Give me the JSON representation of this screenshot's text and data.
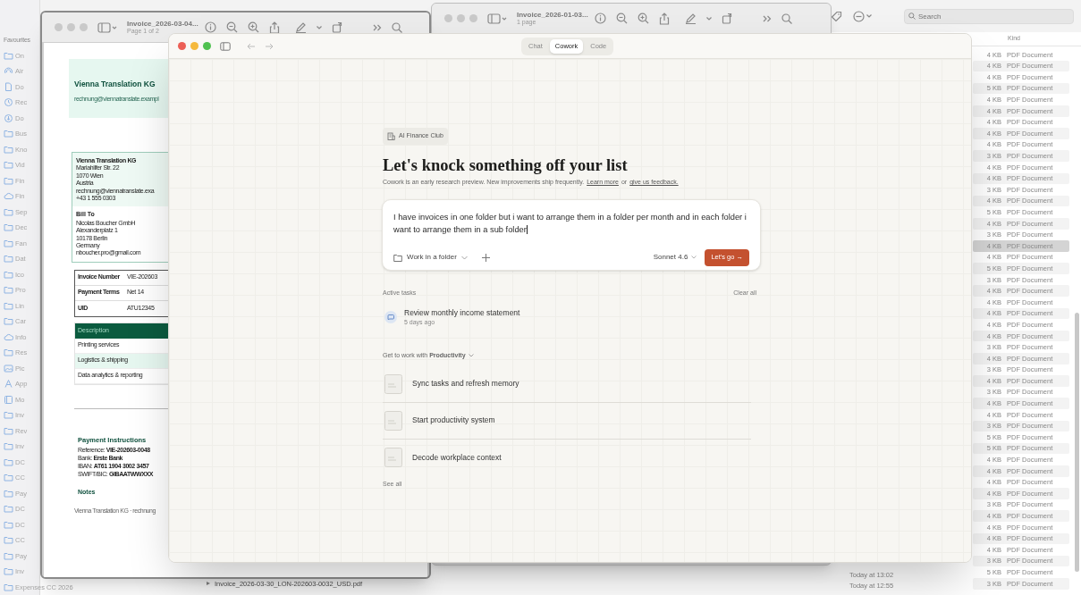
{
  "finder": {
    "sidebar_heading": "Favourites",
    "sidebar_items": [
      {
        "label": "On",
        "kind": "folder"
      },
      {
        "label": "Air",
        "kind": "airdrop"
      },
      {
        "label": "Do",
        "kind": "doc"
      },
      {
        "label": "Rec",
        "kind": "clock"
      },
      {
        "label": "Do",
        "kind": "download"
      },
      {
        "label": "Bus",
        "kind": "folder"
      },
      {
        "label": "Kno",
        "kind": "folder"
      },
      {
        "label": "Vid",
        "kind": "folder"
      },
      {
        "label": "Fin",
        "kind": "folder"
      },
      {
        "label": "Fin",
        "kind": "cloud"
      },
      {
        "label": "Sep",
        "kind": "folder"
      },
      {
        "label": "Dec",
        "kind": "folder"
      },
      {
        "label": "Fan",
        "kind": "folder"
      },
      {
        "label": "Dat",
        "kind": "folder"
      },
      {
        "label": "Ico",
        "kind": "folder"
      },
      {
        "label": "Pro",
        "kind": "folder"
      },
      {
        "label": "Lin",
        "kind": "folder"
      },
      {
        "label": "Car",
        "kind": "folder"
      },
      {
        "label": "Info",
        "kind": "cloud"
      },
      {
        "label": "Res",
        "kind": "folder"
      },
      {
        "label": "Pic",
        "kind": "photo"
      },
      {
        "label": "App",
        "kind": "apps"
      },
      {
        "label": "Mo",
        "kind": "film"
      },
      {
        "label": "Inv",
        "kind": "folder"
      },
      {
        "label": "Rev",
        "kind": "folder"
      },
      {
        "label": "Inv",
        "kind": "folder"
      },
      {
        "label": "DC",
        "kind": "folder"
      },
      {
        "label": "CC",
        "kind": "folder"
      },
      {
        "label": "Pay",
        "kind": "folder"
      },
      {
        "label": "DC",
        "kind": "folder"
      },
      {
        "label": "DC",
        "kind": "folder"
      },
      {
        "label": "CC",
        "kind": "folder"
      },
      {
        "label": "Pay",
        "kind": "folder"
      },
      {
        "label": "Inv",
        "kind": "folder"
      },
      {
        "label": "Expenses CC 2026",
        "kind": "folder"
      }
    ],
    "search": {
      "placeholder": "Search"
    },
    "column_kind": "Kind",
    "rows": [
      {
        "size": "4 KB",
        "kind": "PDF Document",
        "selected": false
      },
      {
        "size": "4 KB",
        "kind": "PDF Document",
        "selected": false
      },
      {
        "size": "4 KB",
        "kind": "PDF Document",
        "selected": false
      },
      {
        "size": "5 KB",
        "kind": "PDF Document",
        "selected": false
      },
      {
        "size": "4 KB",
        "kind": "PDF Document",
        "selected": false
      },
      {
        "size": "4 KB",
        "kind": "PDF Document",
        "selected": false
      },
      {
        "size": "4 KB",
        "kind": "PDF Document",
        "selected": false
      },
      {
        "size": "4 KB",
        "kind": "PDF Document",
        "selected": false
      },
      {
        "size": "4 KB",
        "kind": "PDF Document",
        "selected": false
      },
      {
        "size": "3 KB",
        "kind": "PDF Document",
        "selected": false
      },
      {
        "size": "4 KB",
        "kind": "PDF Document",
        "selected": false
      },
      {
        "size": "4 KB",
        "kind": "PDF Document",
        "selected": false
      },
      {
        "size": "3 KB",
        "kind": "PDF Document",
        "selected": false
      },
      {
        "size": "4 KB",
        "kind": "PDF Document",
        "selected": false
      },
      {
        "size": "5 KB",
        "kind": "PDF Document",
        "selected": false
      },
      {
        "size": "4 KB",
        "kind": "PDF Document",
        "selected": false
      },
      {
        "size": "3 KB",
        "kind": "PDF Document",
        "selected": false
      },
      {
        "size": "4 KB",
        "kind": "PDF Document",
        "selected": true
      },
      {
        "size": "4 KB",
        "kind": "PDF Document",
        "selected": false
      },
      {
        "size": "5 KB",
        "kind": "PDF Document",
        "selected": false
      },
      {
        "size": "3 KB",
        "kind": "PDF Document",
        "selected": false
      },
      {
        "size": "4 KB",
        "kind": "PDF Document",
        "selected": false
      },
      {
        "size": "4 KB",
        "kind": "PDF Document",
        "selected": false
      },
      {
        "size": "4 KB",
        "kind": "PDF Document",
        "selected": false
      },
      {
        "size": "4 KB",
        "kind": "PDF Document",
        "selected": false
      },
      {
        "size": "4 KB",
        "kind": "PDF Document",
        "selected": false
      },
      {
        "size": "3 KB",
        "kind": "PDF Document",
        "selected": false
      },
      {
        "size": "4 KB",
        "kind": "PDF Document",
        "selected": false
      },
      {
        "size": "3 KB",
        "kind": "PDF Document",
        "selected": false
      },
      {
        "size": "4 KB",
        "kind": "PDF Document",
        "selected": false
      },
      {
        "size": "3 KB",
        "kind": "PDF Document",
        "selected": false
      },
      {
        "size": "4 KB",
        "kind": "PDF Document",
        "selected": false
      },
      {
        "size": "4 KB",
        "kind": "PDF Document",
        "selected": false
      },
      {
        "size": "3 KB",
        "kind": "PDF Document",
        "selected": false
      },
      {
        "size": "5 KB",
        "kind": "PDF Document",
        "selected": false
      },
      {
        "size": "5 KB",
        "kind": "PDF Document",
        "selected": false
      },
      {
        "size": "4 KB",
        "kind": "PDF Document",
        "selected": false
      },
      {
        "size": "4 KB",
        "kind": "PDF Document",
        "selected": false
      },
      {
        "size": "4 KB",
        "kind": "PDF Document",
        "selected": false
      },
      {
        "size": "4 KB",
        "kind": "PDF Document",
        "selected": false
      },
      {
        "size": "3 KB",
        "kind": "PDF Document",
        "selected": false
      },
      {
        "size": "4 KB",
        "kind": "PDF Document",
        "selected": false
      },
      {
        "size": "4 KB",
        "kind": "PDF Document",
        "selected": false
      },
      {
        "size": "4 KB",
        "kind": "PDF Document",
        "selected": false
      },
      {
        "size": "4 KB",
        "kind": "PDF Document",
        "selected": false
      },
      {
        "size": "3 KB",
        "kind": "PDF Document",
        "selected": false
      },
      {
        "size": "5 KB",
        "kind": "PDF Document",
        "selected": false,
        "date": "Today at 13:02"
      },
      {
        "size": "3 KB",
        "kind": "PDF Document",
        "selected": false,
        "date": "Today at 12:55",
        "name": "Invoice_2026-03-30_LON-202603-0032_USD.pdf"
      }
    ]
  },
  "preview_back": {
    "title": "Invoice_2026-01-03...",
    "subtitle": "1 page"
  },
  "preview_front": {
    "title": "Invoice_2026-03-04...",
    "subtitle": "Page 1 of 2",
    "document": {
      "company": "Vienna Translation KG",
      "company_email": "rechnung@viennatranslate.exampl",
      "sender_lines": [
        "Vienna Translation KG",
        "Mariahilfer Str. 22",
        "1070 Wien",
        "Austria",
        "rechnung@viennatranslate.exa",
        "+43 1 555 0303"
      ],
      "bill_to_heading": "Bill To",
      "bill_to_lines": [
        "Nicolas Boucher GmbH",
        "Alexanderplatz 1",
        "10178 Berlin",
        "Germany",
        "nboucher.pro@gmail.com"
      ],
      "details": [
        {
          "label": "Invoice Number",
          "value": "VIE-202603"
        },
        {
          "label": "Payment Terms",
          "value": "Net 14"
        },
        {
          "label": "UID",
          "value": "ATU12345"
        }
      ],
      "items_heading": "Description",
      "items": [
        {
          "text": "Printing services",
          "highlighted": false
        },
        {
          "text": "Logistics & shipping",
          "highlighted": true
        },
        {
          "text": "Data analytics & reporting",
          "highlighted": false
        }
      ],
      "payment_heading": "Payment Instructions",
      "payment_lines": [
        "Reference: **VIE-202603-0048**",
        "Bank: **Erste Bank**",
        "IBAN: **AT61 1904 3002 3457**",
        "SWIFT/BIC: **GIBAATWWXXX**"
      ],
      "notes_heading": "Notes",
      "footer": "Vienna Translation KG · rechnung"
    }
  },
  "cowork": {
    "tabs": [
      {
        "label": "Chat",
        "selected": false
      },
      {
        "label": "Cowork",
        "selected": true
      },
      {
        "label": "Code",
        "selected": false
      }
    ],
    "workspace_chip": "AI Finance Club",
    "heading": "Let's knock something off your list",
    "subtitle": [
      {
        "kind": "text",
        "text": "Cowork is an early research preview. New improvements ship frequently."
      },
      {
        "kind": "link",
        "text": "Learn more"
      },
      {
        "kind": "text",
        "text": "or"
      },
      {
        "kind": "link",
        "text": "give us feedback."
      }
    ],
    "prompt": {
      "value": "I have invoices in one folder but i want to arrange them in a folder per month and in each folder i want to arrange them in a sub folder",
      "folder_button": "Work in a folder",
      "model": "Sonnet 4.6",
      "submit": "Let's go →"
    },
    "active_tasks": {
      "heading": "Active tasks",
      "clear": "Clear all",
      "tasks": [
        {
          "title": "Review monthly income statement",
          "time": "5 days ago"
        }
      ]
    },
    "productivity": {
      "heading": "Get to work with **Productivity**",
      "items": [
        "Sync tasks and refresh memory",
        "Start productivity system",
        "Decode workplace context"
      ],
      "see_all": "See all"
    }
  }
}
